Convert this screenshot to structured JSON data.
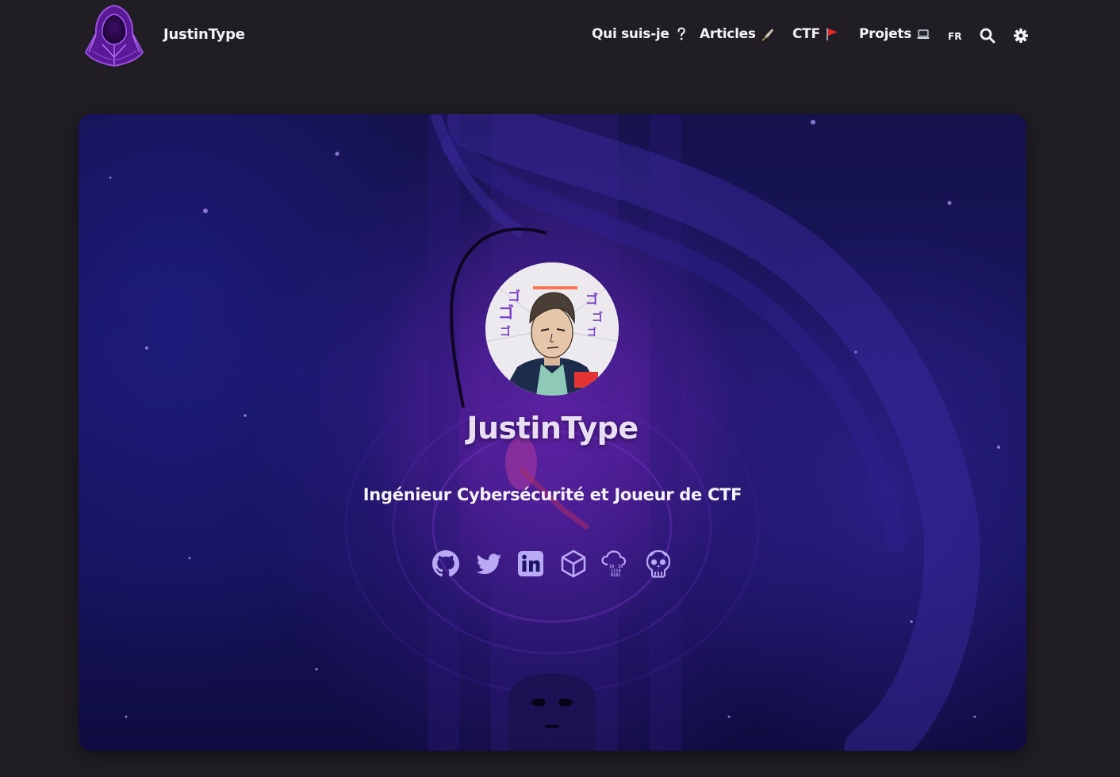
{
  "header": {
    "brand": "JustinType",
    "nav": [
      {
        "label": "Qui suis-je",
        "emoji": "?"
      },
      {
        "label": "Articles",
        "emoji": "pencil"
      },
      {
        "label": "CTF",
        "emoji": "flag"
      },
      {
        "label": "Projets",
        "emoji": "laptop"
      }
    ],
    "language": "FR",
    "icons": {
      "search": "search-icon",
      "theme": "gear-icon"
    }
  },
  "hero": {
    "title": "JustinType",
    "subtitle": "Ingénieur Cybersécurité et Joueur de CTF",
    "socials": [
      {
        "name": "github-icon"
      },
      {
        "name": "twitter-icon"
      },
      {
        "name": "linkedin-icon"
      },
      {
        "name": "hackthebox-icon"
      },
      {
        "name": "rootme-icon"
      },
      {
        "name": "tryhackme-icon"
      }
    ]
  },
  "colors": {
    "page_bg": "#211d25",
    "logo_purple": "#6a1fb0",
    "hero_deep": "#16135a",
    "hero_glow": "#9628c8",
    "title": "#e9dff3"
  }
}
